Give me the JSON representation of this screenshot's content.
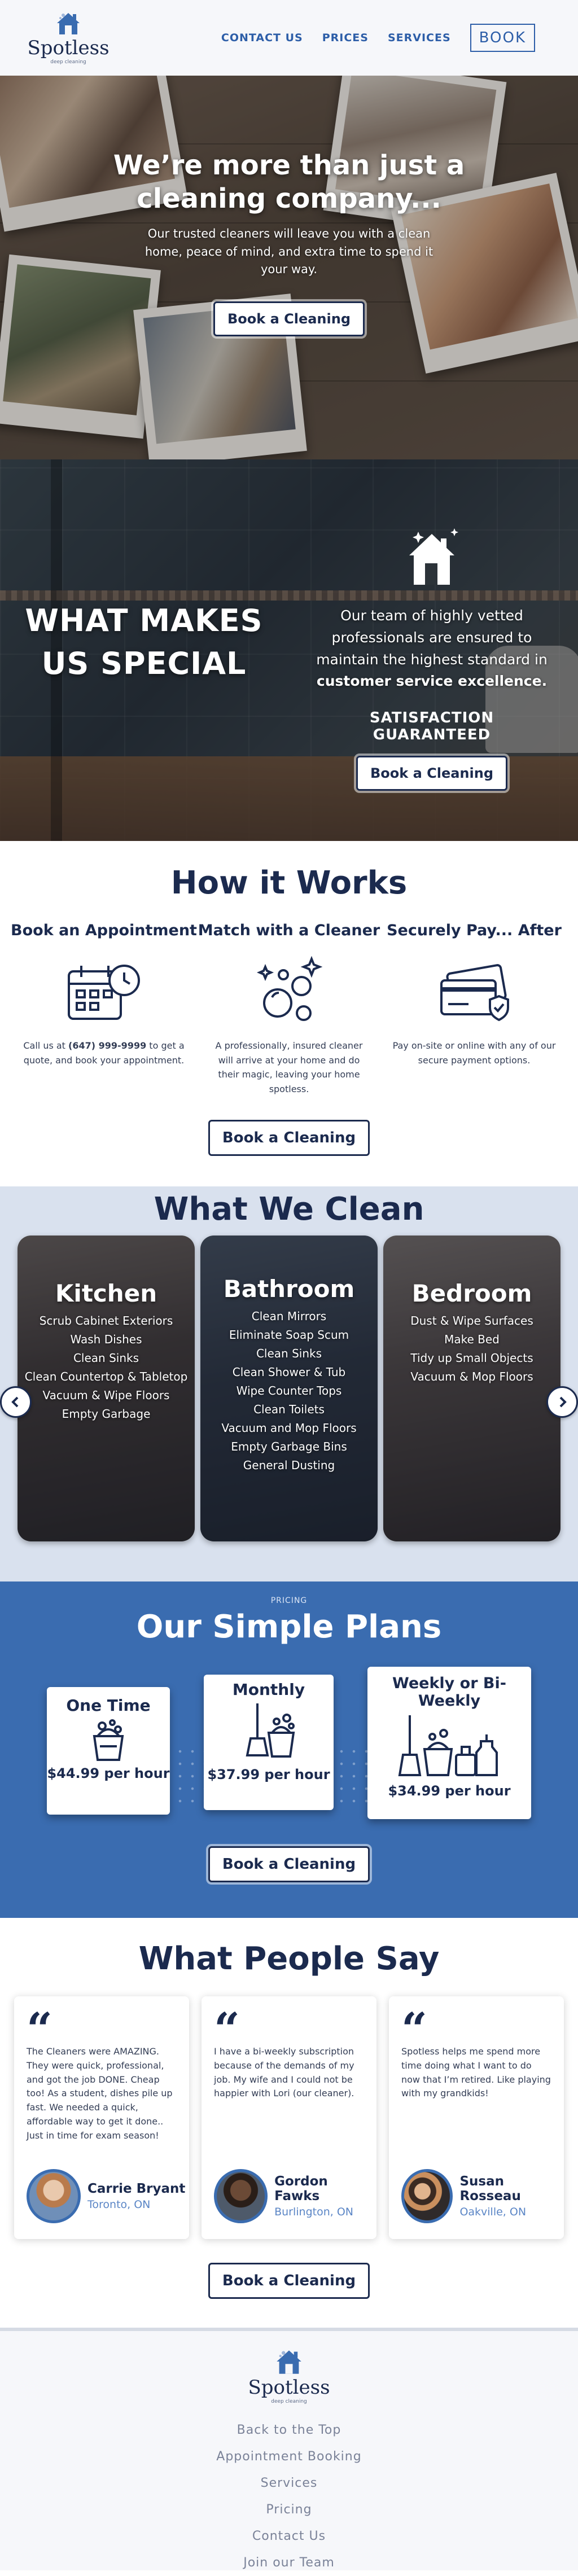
{
  "header": {
    "brand": "Spotless",
    "brand_sub": "deep cleaning",
    "nav": [
      "CONTACT US",
      "PRICES",
      "SERVICES"
    ],
    "book": "BOOK"
  },
  "hero": {
    "title": "We’re more than just a cleaning company...",
    "subtitle": "Our trusted cleaners will leave you with a clean home, peace of mind, and extra time to spend it your way.",
    "cta": "Book a Cleaning"
  },
  "special": {
    "title": "WHAT MAKES US SPECIAL",
    "text_before": "Our team of highly vetted professionals are ensured to maintain the highest standard in ",
    "text_bold": "customer service excellence.",
    "guarantee": "SATISFACTION GUARANTEED",
    "cta": "Book a Cleaning"
  },
  "how": {
    "title": "How it Works",
    "steps": [
      {
        "title": "Book an Appointment",
        "text_pre": "Call us at ",
        "phone": "(647) 999-9999",
        "text_post": " to get a quote, and book your appointment.",
        "icon": "calendar-clock-icon"
      },
      {
        "title": "Match with a Cleaner",
        "text": "A professionally, insured cleaner will arrive at your home and do their magic, leaving your home spotless.",
        "icon": "sparkle-bubbles-icon"
      },
      {
        "title": "Securely Pay... After",
        "text": "Pay on-site or online with any of our secure payment options.",
        "icon": "secure-card-icon"
      }
    ],
    "cta": "Book a Cleaning"
  },
  "clean": {
    "title": "What We Clean",
    "cards": [
      {
        "title": "Kitchen",
        "items": [
          "Scrub Cabinet Exteriors",
          "Wash Dishes",
          "Clean Sinks",
          "Clean Countertop & Tabletop",
          "Vacuum & Wipe Floors",
          "Empty Garbage"
        ]
      },
      {
        "title": "Bathroom",
        "items": [
          "Clean Mirrors",
          "Eliminate Soap Scum",
          "Clean Sinks",
          "Clean Shower & Tub",
          "Wipe Counter Tops",
          "Clean Toilets",
          "Vacuum and Mop Floors",
          "Empty Garbage Bins",
          "General Dusting"
        ]
      },
      {
        "title": "Bedroom",
        "items": [
          "Dust & Wipe Surfaces",
          "Make Bed",
          "Tidy up Small Objects",
          "Vacuum & Mop Floors"
        ]
      }
    ]
  },
  "pricing": {
    "kicker": "PRICING",
    "title": "Our Simple Plans",
    "plans": [
      {
        "name": "One Time",
        "price": "$44.99 per hour"
      },
      {
        "name": "Monthly",
        "price": "$37.99 per hour"
      },
      {
        "name": "Weekly or Bi-Weekly",
        "price": "$34.99 per hour"
      }
    ],
    "cta": "Book a Cleaning"
  },
  "testimonials": {
    "title": "What People Say",
    "items": [
      {
        "text": "The Cleaners were AMAZING. They were quick, professional, and got the job DONE. Cheap too! As a student, dishes pile up fast. We needed a quick, affordable way to get it done.. Just in time for exam season!",
        "name": "Carrie Bryant",
        "location": "Toronto, ON"
      },
      {
        "text": "I have a bi-weekly subscription because of the demands of my job. My wife and I could not be happier with Lori (our cleaner).",
        "name": "Gordon Fawks",
        "location": "Burlington, ON"
      },
      {
        "text": "Spotless helps me spend more time doing what I want to do now that I’m retired. Like playing with my grandkids!",
        "name": "Susan Rosseau",
        "location": "Oakville, ON"
      }
    ],
    "cta": "Book a Cleaning"
  },
  "footer": {
    "brand": "Spotless",
    "brand_sub": "deep cleaning",
    "links": [
      "Back to the Top",
      "Appointment Booking",
      "Services",
      "Pricing",
      "Contact Us",
      "Join our Team"
    ]
  },
  "colors": {
    "navy": "#1b2a4e",
    "blue": "#3a6cb0",
    "link": "#2d5ea8",
    "light": "#d9e1ee"
  }
}
